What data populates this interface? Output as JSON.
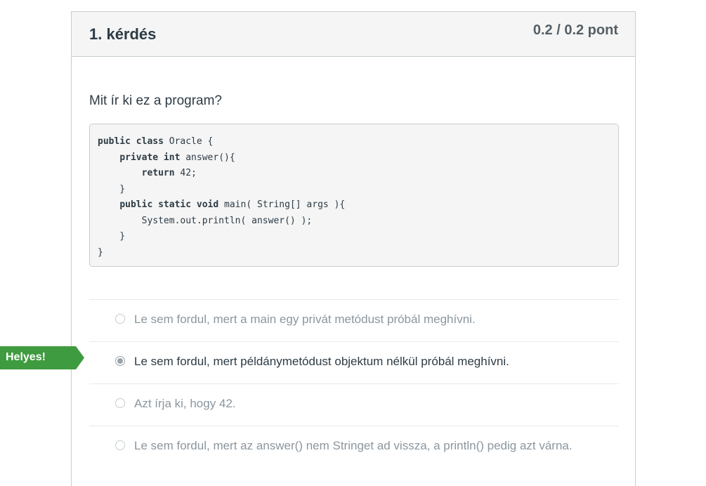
{
  "question": {
    "title": "1. kérdés",
    "points": "0.2 / 0.2 pont",
    "text": "Mit ír ki ez a program?"
  },
  "code": [
    [
      {
        "t": "public class",
        "kw": true
      },
      {
        "t": " Oracle {"
      }
    ],
    [
      {
        "t": "    "
      },
      {
        "t": "private int",
        "kw": true
      },
      {
        "t": " answer(){"
      }
    ],
    [
      {
        "t": "        "
      },
      {
        "t": "return",
        "kw": true
      },
      {
        "t": " 42;"
      }
    ],
    [
      {
        "t": "    }"
      }
    ],
    [
      {
        "t": "    "
      },
      {
        "t": "public static void",
        "kw": true
      },
      {
        "t": " main( String[] args ){"
      }
    ],
    [
      {
        "t": "        System.out.println( answer() );"
      }
    ],
    [
      {
        "t": "    }"
      }
    ],
    [
      {
        "t": "}"
      }
    ]
  ],
  "answers": [
    {
      "label": "Le sem fordul, mert a main egy privát metódust próbál meghívni.",
      "selected": false
    },
    {
      "label": "Le sem fordul, mert példánymetódust objektum nélkül próbál meghívni.",
      "selected": true
    },
    {
      "label": "Azt írja ki, hogy 42.",
      "selected": false
    },
    {
      "label": "Le sem fordul, mert az answer() nem Stringet ad vissza, a println() pedig azt várna.",
      "selected": false
    }
  ],
  "correct_flag": {
    "label": "Helyes!",
    "color": "#3f9b3f"
  },
  "colors": {
    "header_bg": "#f5f5f5",
    "text": "#2d3b45",
    "muted_text": "#8b969e",
    "border": "#c7cdd1"
  }
}
